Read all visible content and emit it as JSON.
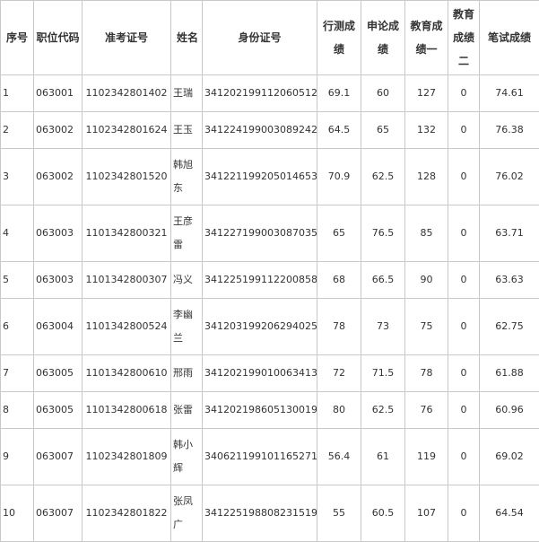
{
  "headers": {
    "seq": "序号",
    "position_code": "职位代码",
    "exam_no": "准考证号",
    "name": "姓名",
    "id_no": "身份证号",
    "xingce": "行测成绩",
    "shenlun": "申论成绩",
    "edu1": "教育成绩一",
    "edu2": "教育成绩二",
    "written": "笔试成绩"
  },
  "rows": [
    {
      "seq": "1",
      "position_code": "063001",
      "exam_no": "1102342801402",
      "name": "王瑞",
      "id_no": "341202199112060512",
      "xingce": "69.1",
      "shenlun": "60",
      "edu1": "127",
      "edu2": "0",
      "written": "74.61"
    },
    {
      "seq": "2",
      "position_code": "063002",
      "exam_no": "1102342801624",
      "name": "王玉",
      "id_no": "341224199003089242",
      "xingce": "64.5",
      "shenlun": "65",
      "edu1": "132",
      "edu2": "0",
      "written": "76.38"
    },
    {
      "seq": "3",
      "position_code": "063002",
      "exam_no": "1102342801520",
      "name": "韩旭东",
      "id_no": "341221199205014653",
      "xingce": "70.9",
      "shenlun": "62.5",
      "edu1": "128",
      "edu2": "0",
      "written": "76.02"
    },
    {
      "seq": "4",
      "position_code": "063003",
      "exam_no": "1101342800321",
      "name": "王彦雷",
      "id_no": "341227199003087035",
      "xingce": "65",
      "shenlun": "76.5",
      "edu1": "85",
      "edu2": "0",
      "written": "63.71"
    },
    {
      "seq": "5",
      "position_code": "063003",
      "exam_no": "1101342800307",
      "name": "冯义",
      "id_no": "341225199112200858",
      "xingce": "68",
      "shenlun": "66.5",
      "edu1": "90",
      "edu2": "0",
      "written": "63.63"
    },
    {
      "seq": "6",
      "position_code": "063004",
      "exam_no": "1101342800524",
      "name": "李幽兰",
      "id_no": "341203199206294025",
      "xingce": "78",
      "shenlun": "73",
      "edu1": "75",
      "edu2": "0",
      "written": "62.75"
    },
    {
      "seq": "7",
      "position_code": "063005",
      "exam_no": "1101342800610",
      "name": "邢雨",
      "id_no": "341202199010063413",
      "xingce": "72",
      "shenlun": "71.5",
      "edu1": "78",
      "edu2": "0",
      "written": "61.88"
    },
    {
      "seq": "8",
      "position_code": "063005",
      "exam_no": "1101342800618",
      "name": "张雷",
      "id_no": "341202198605130019",
      "xingce": "80",
      "shenlun": "62.5",
      "edu1": "76",
      "edu2": "0",
      "written": "60.96"
    },
    {
      "seq": "9",
      "position_code": "063007",
      "exam_no": "1102342801809",
      "name": "韩小辉",
      "id_no": "340621199101165271",
      "xingce": "56.4",
      "shenlun": "61",
      "edu1": "119",
      "edu2": "0",
      "written": "69.02"
    },
    {
      "seq": "10",
      "position_code": "063007",
      "exam_no": "1102342801822",
      "name": "张凤广",
      "id_no": "341225198808231519",
      "xingce": "55",
      "shenlun": "60.5",
      "edu1": "107",
      "edu2": "0",
      "written": "64.54"
    }
  ]
}
